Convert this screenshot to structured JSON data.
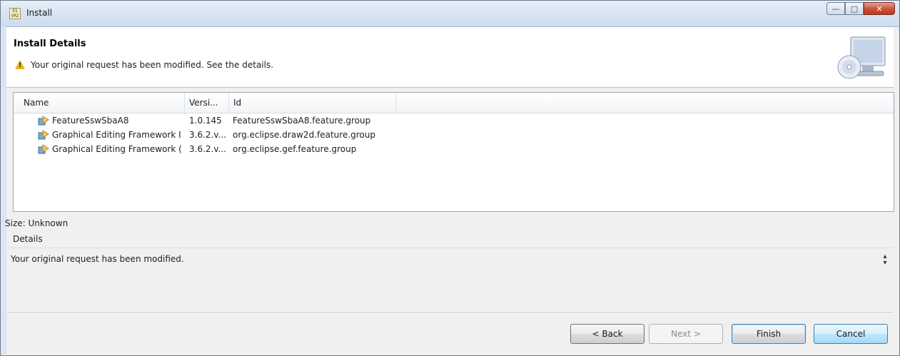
{
  "window": {
    "title": "Install",
    "icon_text": "ES VRZ"
  },
  "header": {
    "title": "Install Details",
    "message": "Your original request has been modified.  See the details."
  },
  "table": {
    "columns": [
      "Name",
      "Versi...",
      "Id"
    ],
    "rows": [
      {
        "name": "FeatureSswSbaA8",
        "version": "1.0.145",
        "id": "FeatureSswSbaA8.feature.group"
      },
      {
        "name": "Graphical Editing Framework I",
        "version": "3.6.2.v...",
        "id": "org.eclipse.draw2d.feature.group"
      },
      {
        "name": "Graphical Editing Framework (",
        "version": "3.6.2.v...",
        "id": "org.eclipse.gef.feature.group"
      }
    ]
  },
  "size_label": "Size: Unknown",
  "details": {
    "label": "Details",
    "text": "Your original request has been modified."
  },
  "buttons": {
    "back": "< Back",
    "next": "Next >",
    "finish": "Finish",
    "cancel": "Cancel"
  },
  "colors": {
    "warning": "#e8b320",
    "accent": "#3c7fb1",
    "close_button": "#c9503b"
  }
}
